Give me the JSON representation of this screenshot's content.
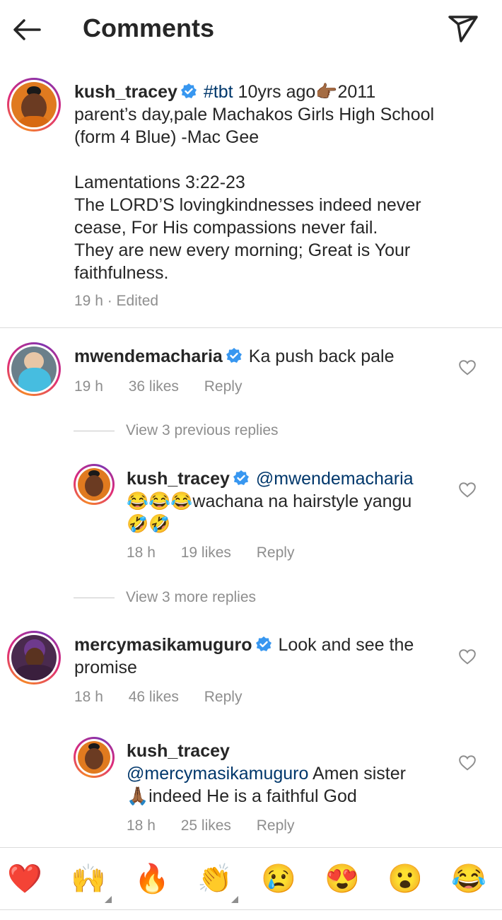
{
  "header": {
    "title": "Comments"
  },
  "caption": {
    "username": "kush_tracey",
    "hashtag": "#tbt",
    "line1_rest": " 10yrs ago👉🏾2011",
    "line2": "parent’s day,pale Machakos Girls High School",
    "line3": "(form 4 Blue) -Mac Gee",
    "verse_ref": "Lamentations 3:22-23",
    "verse_1": "The LORD’S lovingkindnesses indeed never",
    "verse_2": "cease, For His compassions never fail.",
    "verse_3": "They are new every morning; Great is Your",
    "verse_4": "faithfulness.",
    "meta": "19 h · Edited"
  },
  "comments": [
    {
      "username": "mwendemacharia",
      "text": "Ka push back pale",
      "time": "19 h",
      "likes": "36 likes",
      "reply": "Reply",
      "view_replies": "View 3 previous replies",
      "replies": [
        {
          "username": "kush_tracey",
          "mention": "@mwendemacharia",
          "line1": "😂😂😂wachana na hairstyle yangu",
          "line2": "🤣🤣",
          "time": "18 h",
          "likes": "19 likes",
          "reply": "Reply"
        }
      ],
      "view_more": "View 3 more replies"
    },
    {
      "username": "mercymasikamuguro",
      "text_line1": "Look and see the",
      "text_line2": "promise",
      "time": "18 h",
      "likes": "46 likes",
      "reply": "Reply",
      "replies": [
        {
          "username": "kush_tracey",
          "mention": "@mercymasikamuguro",
          "line1_rest": " Amen sister",
          "line2": "🙏🏾indeed He is a faithful God",
          "time": "18 h",
          "likes": "25 likes",
          "reply": "Reply"
        }
      ]
    }
  ],
  "emoji_bar": [
    "❤️",
    "🙌",
    "🔥",
    "👏",
    "😢",
    "😍",
    "😮",
    "😂"
  ],
  "colors": {
    "verified": "#3897f0",
    "mention": "#00376b",
    "muted": "#8e8e8e"
  }
}
